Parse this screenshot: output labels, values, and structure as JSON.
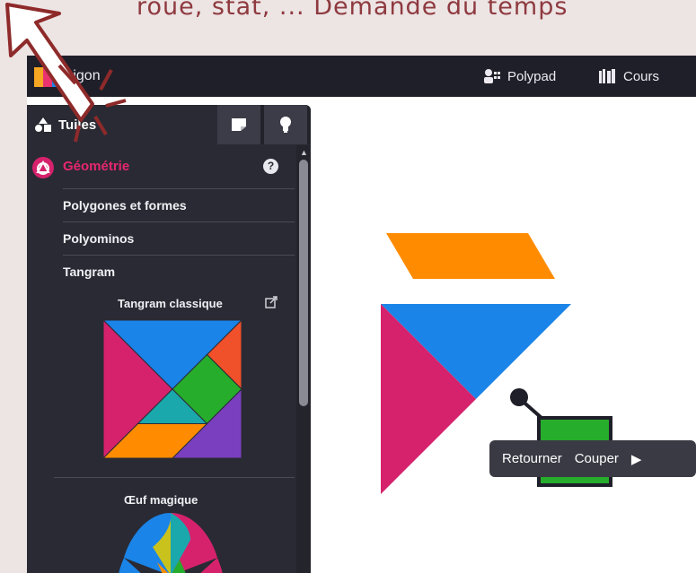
{
  "caption": "roue, stat, ... Demande du temps",
  "topbar": {
    "brand": "thigon",
    "nav": [
      {
        "label": "Polypad",
        "icon": "polypad-icon"
      },
      {
        "label": "Cours",
        "icon": "courses-icon"
      }
    ]
  },
  "sidebar": {
    "tabs": [
      {
        "label": "Tuiles",
        "icon": "shapes-icon"
      },
      {
        "label": "",
        "icon": "note-icon"
      },
      {
        "label": "",
        "icon": "lightbulb-icon"
      }
    ],
    "section": {
      "title": "Géométrie",
      "icon": "geometry-icon",
      "help": "?"
    },
    "items": [
      "Polygones et formes",
      "Polyominos",
      "Tangram"
    ],
    "tangram_title": "Tangram classique",
    "egg_title": "Œuf magique"
  },
  "toolbar": {
    "actions": [
      "Retourner",
      "Couper"
    ],
    "more": "▶"
  },
  "colors": {
    "pink": "#d6226c",
    "blue": "#1a84e8",
    "orange": "#ff8c00",
    "green": "#27ad2c",
    "red_orange": "#f0502a",
    "teal": "#1aa8ad",
    "purple": "#7a3fbf",
    "dark": "#1f1f29",
    "arrow": "#8e2a2a"
  }
}
